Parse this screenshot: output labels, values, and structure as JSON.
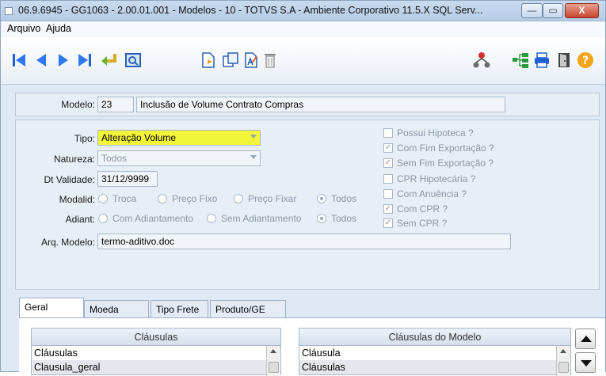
{
  "window": {
    "title": "06.9.6945 - GG1063 - 2.00.01.001 - Modelos - 10 - TOTVS S.A - Ambiente Corporativo 11.5.X SQL Serv...",
    "minimize_glyph": "—",
    "maximize_glyph": "▭",
    "close_glyph": "X"
  },
  "menu": {
    "items": [
      "Arquivo",
      "Ajuda"
    ]
  },
  "toolbar": {
    "icons": [
      "first-record-icon",
      "previous-record-icon",
      "next-record-icon",
      "last-record-icon",
      "return-icon",
      "view-icon",
      "new-document-icon",
      "copy-icon",
      "edit-icon",
      "delete-icon",
      "network-icon",
      "tree-icon",
      "print-icon",
      "exit-door-icon",
      "help-icon"
    ]
  },
  "header": {
    "model_label": "Modelo:",
    "model_code": "23",
    "model_description": "Inclusão de Volume Contrato Compras"
  },
  "form": {
    "tipo_label": "Tipo:",
    "tipo_value": "Alteração Volume",
    "natureza_label": "Natureza:",
    "natureza_value": "Todos",
    "validade_label": "Dt Validade:",
    "validade_value": "31/12/9999",
    "modalid_label": "Modalid:",
    "modalid_options": [
      "Troca",
      "Preço Fixo",
      "Preço Fixar",
      "Todos"
    ],
    "modalid_selected": "Todos",
    "adiant_label": "Adiant:",
    "adiant_options": [
      "Com Adiantamento",
      "Sem Adiantamento",
      "Todos"
    ],
    "adiant_selected": "Todos",
    "arquivo_label": "Arq. Modelo:",
    "arquivo_value": "termo-aditivo.doc"
  },
  "checkboxes": [
    {
      "label": "Possui Hipoteca ?",
      "checked": false
    },
    {
      "label": "Com Fim Exportação ?",
      "checked": true
    },
    {
      "label": "Sem Fim Exportação ?",
      "checked": true
    },
    {
      "label": "CPR Hipotecária ?",
      "checked": false
    },
    {
      "label": "Com Anuência ?",
      "checked": false
    },
    {
      "label": "Com CPR ?",
      "checked": true
    },
    {
      "label": "Sem CPR ?",
      "checked": true
    }
  ],
  "tabs": [
    "Geral",
    "Moeda",
    "Tipo Frete",
    "Produto/GE"
  ],
  "active_tab": "Geral",
  "left_grid": {
    "title": "Cláusulas",
    "rows": [
      "Cláusulas",
      "Clausula_geral"
    ]
  },
  "right_grid": {
    "title": "Cláusulas do Modelo",
    "rows": [
      "Cláusula",
      "Cláusulas"
    ]
  },
  "colors": {
    "highlight": "#f2f53a",
    "panel": "#e8eef6",
    "titlebar": "#c9dbf0",
    "close_button": "#c8452f"
  }
}
